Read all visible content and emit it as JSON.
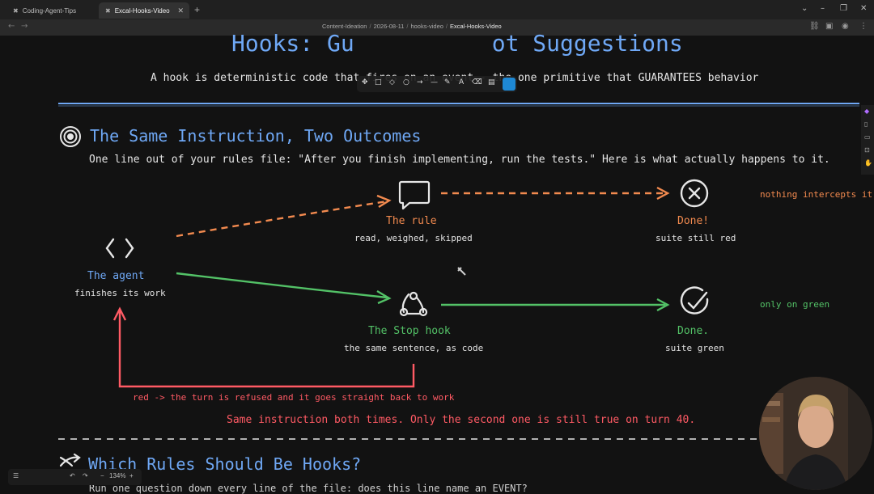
{
  "tabs": [
    {
      "label": "Coding-Agent-Tips",
      "icon": "excalidraw-icon",
      "active": false
    },
    {
      "label": "Excal-Hooks-Video",
      "icon": "excalidraw-icon",
      "active": true
    }
  ],
  "breadcrumb": [
    "Content-Ideation",
    "2026-08-11",
    "hooks-video",
    "Excal-Hooks-Video"
  ],
  "title": {
    "left": "Hooks: Gu",
    "right": "ot Suggestions",
    "subtitle": "A hook is deterministic code that fires on an event - the one primitive that GUARANTEES behavior"
  },
  "section1": {
    "heading": "The Same Instruction, Two Outcomes",
    "description": "One line out of your rules file: \"After you finish implementing, run the tests.\" Here is what actually happens to it."
  },
  "diagram": {
    "agent_label": "The agent",
    "agent_sub": "finishes its work",
    "rule_label": "The rule",
    "rule_sub": "read, weighed, skipped",
    "done_bad_label": "Done!",
    "done_bad_sub": "suite still red",
    "bad_note": "nothing intercepts it",
    "hook_label": "The Stop hook",
    "hook_sub": "the same sentence, as code",
    "done_good_label": "Done.",
    "done_good_sub": "suite green",
    "good_note": "only on green",
    "loop_note": "red  ->  the turn is refused and it goes straight back to work",
    "conclusion": "Same instruction both times. Only the second one is still true on turn 40.",
    "colors": {
      "orange": "#f28a4f",
      "green": "#53c267",
      "red": "#ff5a64",
      "blue": "#6fa8f5"
    }
  },
  "section2": {
    "heading": "Which Rules Should Be Hooks?",
    "partial": "Run one question down every line of the file: does this line name an EVENT?"
  },
  "zoom": {
    "level": "134%"
  }
}
